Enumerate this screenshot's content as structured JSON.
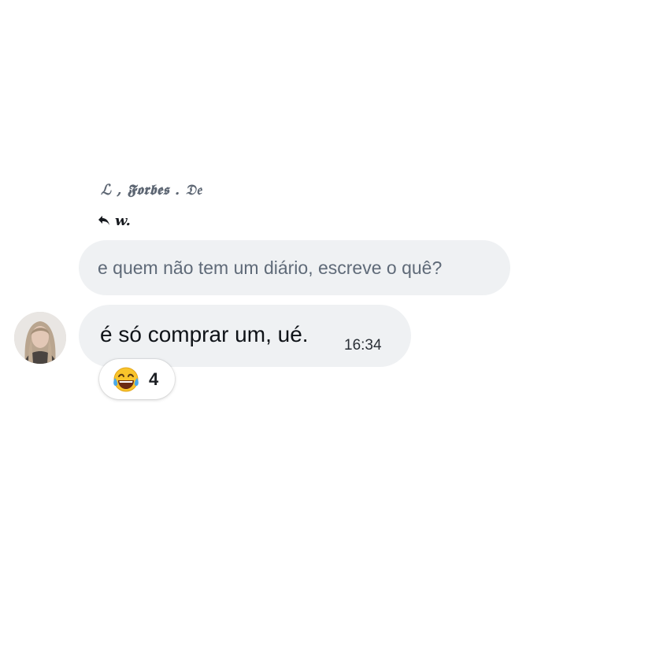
{
  "conversation": {
    "sender_name": "ℒ , 𝕱𝖔𝖗𝖇𝖊𝖘 . 𝔇𝔢",
    "reply": {
      "icon": "reply-arrow-icon",
      "target": "w."
    },
    "quoted_message": {
      "text": "e quem não tem um diário, escreve o quê?"
    },
    "message": {
      "text": "é só comprar um, ué.",
      "time": "16:34",
      "avatar": "user-avatar"
    },
    "reaction": {
      "emoji": "face-with-tears-of-joy-icon",
      "count": "4"
    }
  },
  "colors": {
    "bubble_background": "#eff1f3",
    "quoted_text": "#5f6a78",
    "message_text": "#0f1318",
    "page_background": "#ffffff"
  }
}
